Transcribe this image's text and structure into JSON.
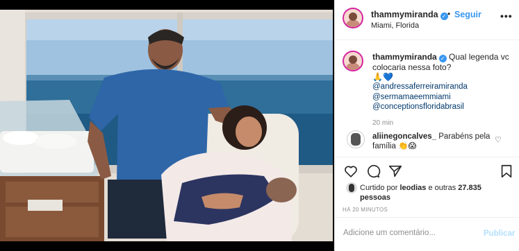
{
  "post": {
    "username": "thammymiranda",
    "separator": "•",
    "follow_label": "Seguir",
    "location": "Miami, Florida",
    "more_label": "•••"
  },
  "caption": {
    "username": "thammymiranda",
    "text": "Qual legenda vc colocaria nessa foto?",
    "emoji_pray": "🙏",
    "emoji_heart": "💙",
    "mentions": [
      "@andressaferreiramiranda",
      "@sermamaeemmiami",
      "@conceptionsfloridabrasil"
    ],
    "time": "20 min"
  },
  "comment": {
    "username": "aliinegoncalves_",
    "text": "Parabéns pela família 👏😱"
  },
  "likes": {
    "prefix": "Curtido por",
    "user": "leodias",
    "middle": "e outras",
    "count": "27.835",
    "suffix": "pessoas"
  },
  "timestamp": "HÁ 20 MINUTOS",
  "add_comment": {
    "placeholder": "Adicione um comentário...",
    "publish_label": "Publicar"
  },
  "colors": {
    "link": "#3897f0",
    "mention": "#00376b",
    "muted": "#8e8e8e",
    "publish_disabled": "#b2dffc"
  },
  "icons": [
    "verified-badge-icon",
    "more-options-icon",
    "heart-icon",
    "comment-icon",
    "share-icon",
    "bookmark-icon"
  ]
}
